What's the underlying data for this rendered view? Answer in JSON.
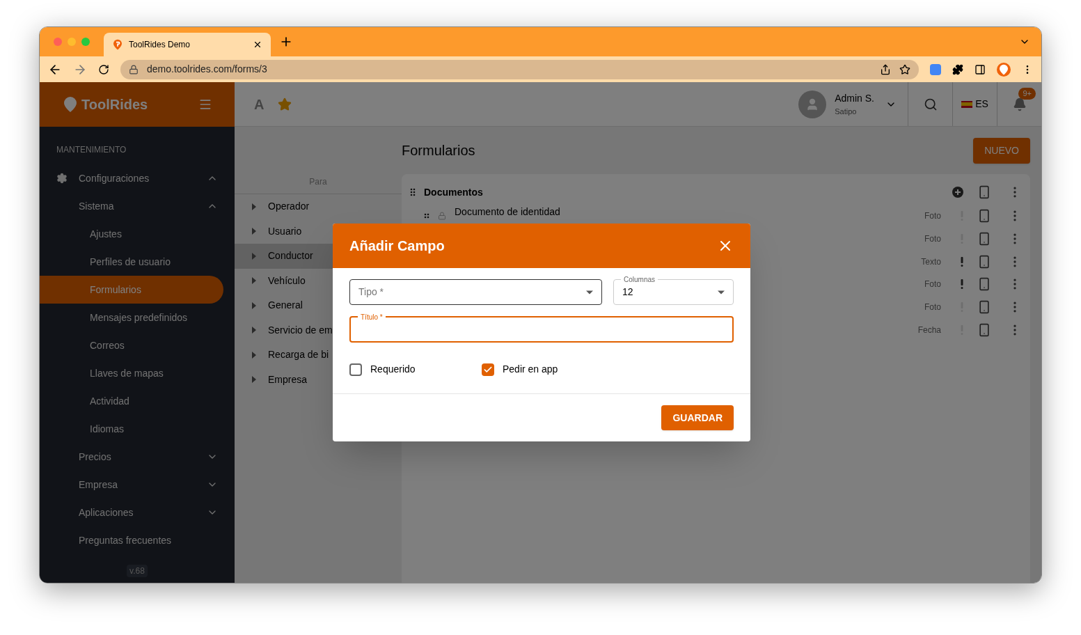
{
  "browser": {
    "tab_title": "ToolRides Demo",
    "url": "demo.toolrides.com/forms/3"
  },
  "sidebar": {
    "logo": "ToolRides",
    "section": "MANTENIMIENTO",
    "items": [
      {
        "label": "Configuraciones",
        "expanded": true,
        "selected": false,
        "children": [
          {
            "label": "Sistema",
            "expanded": true,
            "selected": false,
            "children": [
              {
                "label": "Ajustes",
                "selected": false
              },
              {
                "label": "Perfiles de usuario",
                "selected": false
              },
              {
                "label": "Formularios",
                "selected": true
              },
              {
                "label": "Mensajes predefinidos",
                "selected": false
              },
              {
                "label": "Correos",
                "selected": false
              },
              {
                "label": "Llaves de mapas",
                "selected": false
              },
              {
                "label": "Actividad",
                "selected": false
              },
              {
                "label": "Idiomas",
                "selected": false
              }
            ]
          },
          {
            "label": "Precios",
            "expanded": false,
            "selected": false
          },
          {
            "label": "Empresa",
            "expanded": false,
            "selected": false
          },
          {
            "label": "Aplicaciones",
            "expanded": false,
            "selected": false
          },
          {
            "label": "Preguntas frecuentes",
            "selected": false
          }
        ]
      }
    ],
    "version": "v.68"
  },
  "topbar": {
    "font_button": "A",
    "user_name": "Admin S.",
    "user_location": "Satipo",
    "language": "ES",
    "notifications": "9+"
  },
  "page": {
    "title": "Formularios",
    "new_button": "NUEVO"
  },
  "categories": {
    "header": "Para",
    "items": [
      {
        "label": "Operador",
        "selected": false
      },
      {
        "label": "Usuario",
        "selected": false
      },
      {
        "label": "Conductor",
        "selected": true
      },
      {
        "label": "Vehículo",
        "selected": false
      },
      {
        "label": "General",
        "selected": false
      },
      {
        "label": "Servicio de em",
        "selected": false
      },
      {
        "label": "Recarga de bi",
        "selected": false
      },
      {
        "label": "Empresa",
        "selected": false
      }
    ]
  },
  "section": {
    "title": "Documentos",
    "fields": [
      {
        "name": "Documento de identidad",
        "type": "Foto",
        "required": false
      },
      {
        "type": "Foto",
        "required": false
      },
      {
        "type": "Texto",
        "required": true
      },
      {
        "type": "Foto",
        "required": true
      },
      {
        "type": "Foto",
        "required": false
      },
      {
        "type": "Fecha",
        "required": false
      }
    ]
  },
  "dialog": {
    "title": "Añadir Campo",
    "type_field": {
      "placeholder": "Tipo *"
    },
    "columns_field": {
      "label": "Columnas",
      "value": "12"
    },
    "title_field": {
      "label": "Título *",
      "focused": true
    },
    "checkboxes": [
      {
        "label": "Requerido",
        "checked": false
      },
      {
        "label": "Pedir en app",
        "checked": true
      }
    ],
    "save_button": "GUARDAR"
  }
}
